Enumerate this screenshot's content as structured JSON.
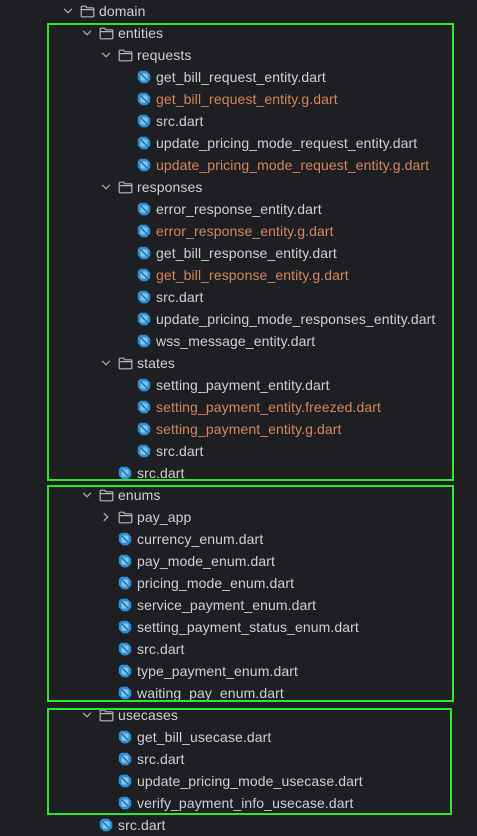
{
  "colors": {
    "background": "#1e1f22",
    "text": "#cfd1d6",
    "generated_text": "#d7875a",
    "highlight_border": "#2ee62e",
    "dart_icon": "#2f8ed6"
  },
  "tree": [
    {
      "label": "domain",
      "type": "folder",
      "depth": 0,
      "expanded": true
    },
    {
      "label": "entities",
      "type": "folder",
      "depth": 1,
      "expanded": true
    },
    {
      "label": "requests",
      "type": "folder",
      "depth": 2,
      "expanded": true
    },
    {
      "label": "get_bill_request_entity.dart",
      "type": "dart",
      "depth": 3,
      "generated": false
    },
    {
      "label": "get_bill_request_entity.g.dart",
      "type": "dart",
      "depth": 3,
      "generated": true
    },
    {
      "label": "src.dart",
      "type": "dart",
      "depth": 3,
      "generated": false
    },
    {
      "label": "update_pricing_mode_request_entity.dart",
      "type": "dart",
      "depth": 3,
      "generated": false
    },
    {
      "label": "update_pricing_mode_request_entity.g.dart",
      "type": "dart",
      "depth": 3,
      "generated": true
    },
    {
      "label": "responses",
      "type": "folder",
      "depth": 2,
      "expanded": true
    },
    {
      "label": "error_response_entity.dart",
      "type": "dart",
      "depth": 3,
      "generated": false
    },
    {
      "label": "error_response_entity.g.dart",
      "type": "dart",
      "depth": 3,
      "generated": true
    },
    {
      "label": "get_bill_response_entity.dart",
      "type": "dart",
      "depth": 3,
      "generated": false
    },
    {
      "label": "get_bill_response_entity.g.dart",
      "type": "dart",
      "depth": 3,
      "generated": true
    },
    {
      "label": "src.dart",
      "type": "dart",
      "depth": 3,
      "generated": false
    },
    {
      "label": "update_pricing_mode_responses_entity.dart",
      "type": "dart",
      "depth": 3,
      "generated": false
    },
    {
      "label": "wss_message_entity.dart",
      "type": "dart",
      "depth": 3,
      "generated": false
    },
    {
      "label": "states",
      "type": "folder",
      "depth": 2,
      "expanded": true
    },
    {
      "label": "setting_payment_entity.dart",
      "type": "dart",
      "depth": 3,
      "generated": false
    },
    {
      "label": "setting_payment_entity.freezed.dart",
      "type": "dart",
      "depth": 3,
      "generated": true
    },
    {
      "label": "setting_payment_entity.g.dart",
      "type": "dart",
      "depth": 3,
      "generated": true
    },
    {
      "label": "src.dart",
      "type": "dart",
      "depth": 3,
      "generated": false
    },
    {
      "label": "src.dart",
      "type": "dart",
      "depth": 2,
      "generated": false
    },
    {
      "label": "enums",
      "type": "folder",
      "depth": 1,
      "expanded": true
    },
    {
      "label": "pay_app",
      "type": "folder",
      "depth": 2,
      "expanded": false
    },
    {
      "label": "currency_enum.dart",
      "type": "dart",
      "depth": 2,
      "generated": false
    },
    {
      "label": "pay_mode_enum.dart",
      "type": "dart",
      "depth": 2,
      "generated": false
    },
    {
      "label": "pricing_mode_enum.dart",
      "type": "dart",
      "depth": 2,
      "generated": false
    },
    {
      "label": "service_payment_enum.dart",
      "type": "dart",
      "depth": 2,
      "generated": false
    },
    {
      "label": "setting_payment_status_enum.dart",
      "type": "dart",
      "depth": 2,
      "generated": false
    },
    {
      "label": "src.dart",
      "type": "dart",
      "depth": 2,
      "generated": false
    },
    {
      "label": "type_payment_enum.dart",
      "type": "dart",
      "depth": 2,
      "generated": false
    },
    {
      "label": "waiting_pay_enum.dart",
      "type": "dart",
      "depth": 2,
      "generated": false
    },
    {
      "label": "usecases",
      "type": "folder",
      "depth": 1,
      "expanded": true
    },
    {
      "label": "get_bill_usecase.dart",
      "type": "dart",
      "depth": 2,
      "generated": false
    },
    {
      "label": "src.dart",
      "type": "dart",
      "depth": 2,
      "generated": false
    },
    {
      "label": "update_pricing_mode_usecase.dart",
      "type": "dart",
      "depth": 2,
      "generated": false
    },
    {
      "label": "verify_payment_info_usecase.dart",
      "type": "dart",
      "depth": 2,
      "generated": false
    },
    {
      "label": "src.dart",
      "type": "dart",
      "depth": 1,
      "generated": false
    }
  ]
}
